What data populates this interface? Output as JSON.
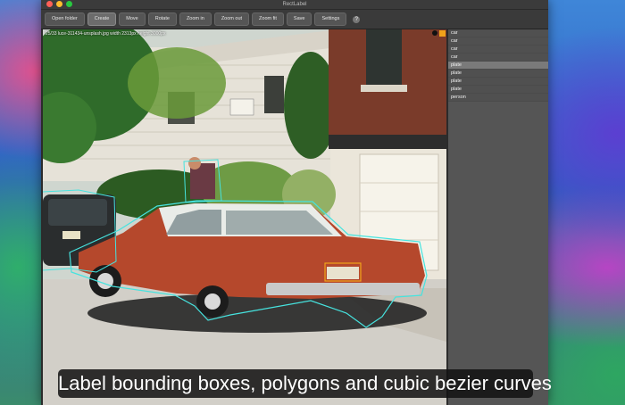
{
  "window": {
    "title": "RectLabel"
  },
  "toolbar": {
    "buttons": [
      {
        "label": "Open folder",
        "active": false
      },
      {
        "label": "Create",
        "active": true
      },
      {
        "label": "Move",
        "active": false
      },
      {
        "label": "Rotate",
        "active": false
      },
      {
        "label": "Zoom in",
        "active": false
      },
      {
        "label": "Zoom out",
        "active": false
      },
      {
        "label": "Zoom fit",
        "active": false
      },
      {
        "label": "Save",
        "active": false
      },
      {
        "label": "Settings",
        "active": false
      }
    ],
    "help_label": "?"
  },
  "canvas": {
    "image_info": "25/33 luce-311434-unsplash.jpg width 2313px height 3000px"
  },
  "labels_panel": {
    "items": [
      {
        "label": "car",
        "selected": false
      },
      {
        "label": "car",
        "selected": false
      },
      {
        "label": "car",
        "selected": false
      },
      {
        "label": "car",
        "selected": false
      },
      {
        "label": "plate",
        "selected": true
      },
      {
        "label": "plate",
        "selected": false
      },
      {
        "label": "plate",
        "selected": false
      },
      {
        "label": "plate",
        "selected": false
      },
      {
        "label": "person",
        "selected": false
      }
    ],
    "swatch_color": "#f0a21a"
  },
  "subtitle": "Label bounding boxes, polygons and cubic bezier curves",
  "colors": {
    "polygon": "#46e3df",
    "box": "#f0a21a"
  }
}
